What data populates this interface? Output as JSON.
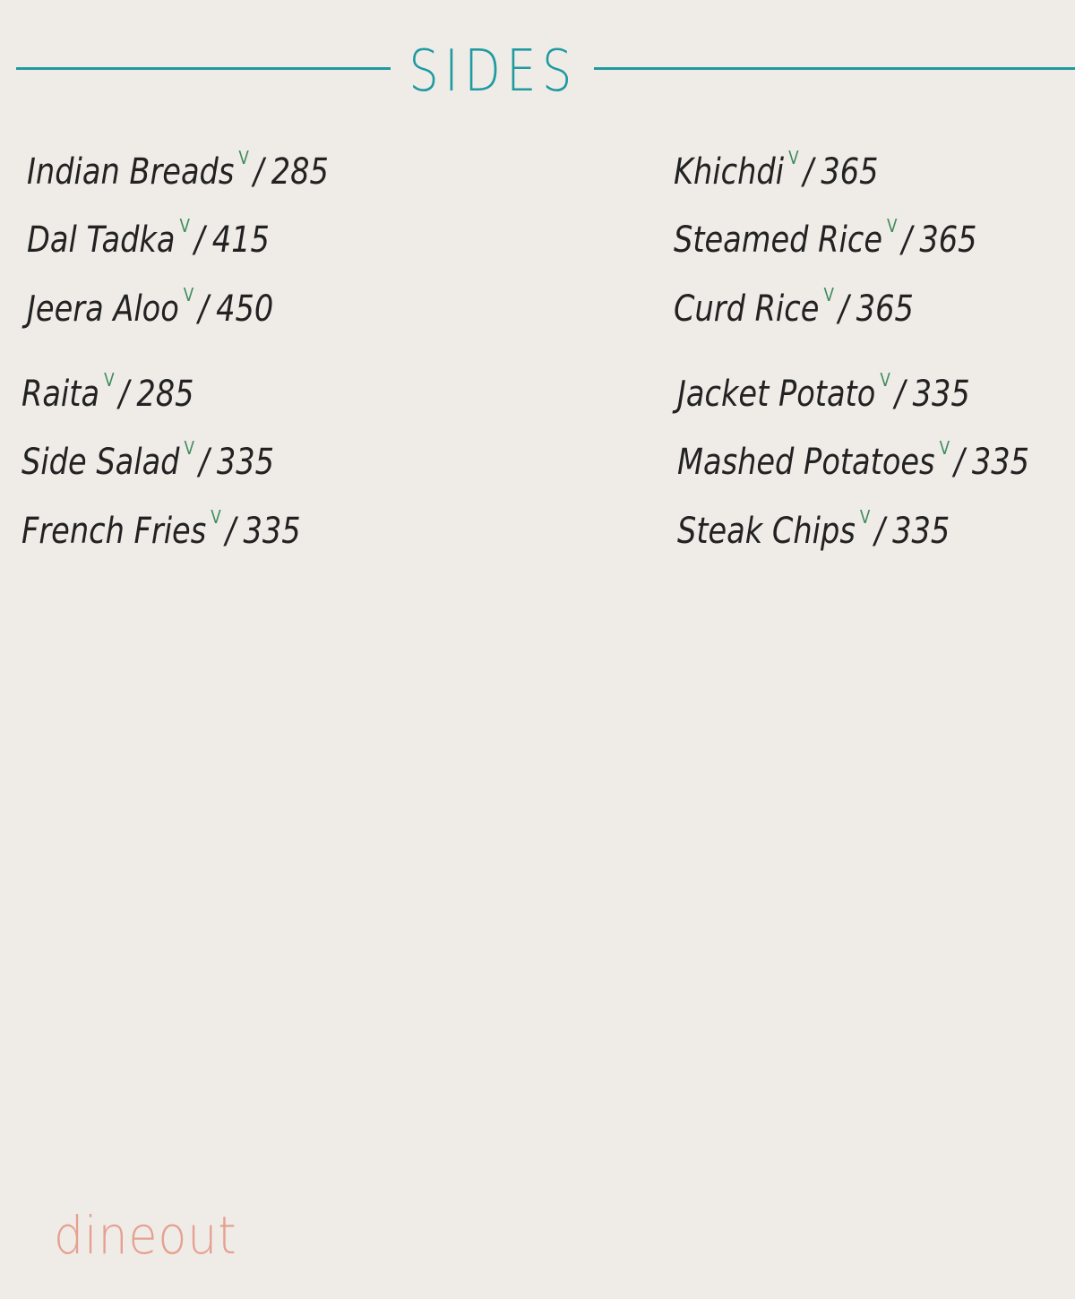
{
  "section": {
    "title": "SIDES"
  },
  "colors": {
    "accent": "#1f9aa0",
    "veg_mark": "#3e8c5c",
    "logo": "#e6a090",
    "background": "#efece8"
  },
  "menu": {
    "left": [
      {
        "name": "Indian Breads",
        "veg": "V",
        "price": "285"
      },
      {
        "name": "Dal Tadka",
        "veg": "V",
        "price": "415"
      },
      {
        "name": "Jeera Aloo",
        "veg": "V",
        "price": "450"
      },
      {
        "name": "Raita",
        "veg": "V",
        "price": "285"
      },
      {
        "name": "Side Salad",
        "veg": "V",
        "price": "335"
      },
      {
        "name": "French Fries",
        "veg": "V",
        "price": "335"
      }
    ],
    "right": [
      {
        "name": "Khichdi",
        "veg": "V",
        "price": "365"
      },
      {
        "name": "Steamed Rice",
        "veg": "V",
        "price": "365"
      },
      {
        "name": "Curd Rice",
        "veg": "V",
        "price": "365"
      },
      {
        "name": "Jacket Potato",
        "veg": "V",
        "price": "335"
      },
      {
        "name": "Mashed Potatoes",
        "veg": "V",
        "price": "335"
      },
      {
        "name": "Steak Chips",
        "veg": "V",
        "price": "335"
      }
    ],
    "separator": "/"
  },
  "watermark": {
    "text": "dineout"
  }
}
